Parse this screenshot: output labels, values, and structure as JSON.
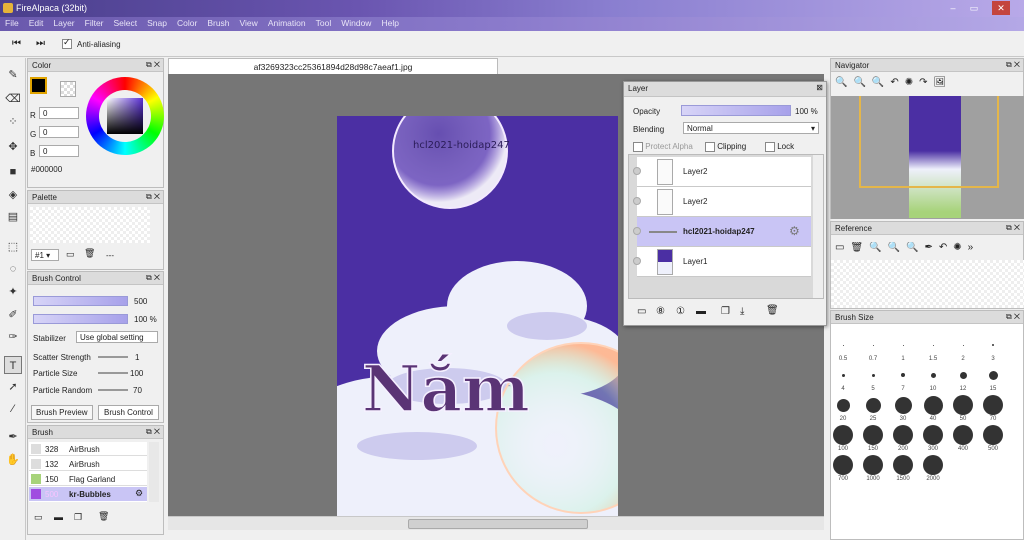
{
  "window": {
    "title": "FireAlpaca (32bit)",
    "controls": [
      "–",
      "▭",
      "✕"
    ]
  },
  "menu": [
    "File",
    "Edit",
    "Layer",
    "Filter",
    "Select",
    "Snap",
    "Color",
    "Brush",
    "View",
    "Animation",
    "Tool",
    "Window",
    "Help"
  ],
  "toolbar": {
    "anti_aliasing": "Anti-aliasing"
  },
  "color_panel": {
    "title": "Color",
    "r_label": "R",
    "g_label": "G",
    "b_label": "B",
    "r": "0",
    "g": "0",
    "b": "0",
    "hex": "#000000"
  },
  "palette_panel": {
    "title": "Palette",
    "set": "#1",
    "more": "---"
  },
  "brush_control": {
    "title": "Brush Control",
    "size": "500",
    "opacity": "100 %",
    "stabilizer_label": "Stabilizer",
    "stabilizer_value": "Use global setting",
    "scatter_label": "Scatter Strength",
    "scatter_value": "1",
    "psize_label": "Particle Size",
    "psize_value": "100",
    "prandom_label": "Particle Random",
    "prandom_value": "70",
    "tab_preview": "Brush Preview",
    "tab_control": "Brush Control"
  },
  "brush_panel": {
    "title": "Brush",
    "items": [
      {
        "size": "328",
        "name": "AirBrush",
        "color": "#dddddd"
      },
      {
        "size": "132",
        "name": "AirBrush",
        "color": "#dddddd"
      },
      {
        "size": "150",
        "name": "Flag Garland",
        "color": "#a7d37a"
      },
      {
        "size": "500",
        "name": "kr-Bubbles",
        "color": "#a04de0"
      }
    ]
  },
  "document": {
    "tab": "af3269323cc25361894d28d98c7aeaf1.jpg",
    "watermark": "hcl2021-hoidap247",
    "art_text": "Nắm"
  },
  "layer_window": {
    "title": "Layer",
    "opacity_label": "Opacity",
    "opacity_value": "100 %",
    "blending_label": "Blending",
    "blending_value": "Normal",
    "protect_alpha": "Protect Alpha",
    "clipping": "Clipping",
    "lock": "Lock",
    "layers": [
      {
        "name": "Layer2"
      },
      {
        "name": "Layer2"
      },
      {
        "name": "hcl2021-hoidap247"
      },
      {
        "name": "Layer1"
      }
    ],
    "selected_index": 2
  },
  "navigator": {
    "title": "Navigator"
  },
  "reference": {
    "title": "Reference"
  },
  "brush_size": {
    "title": "Brush Size",
    "sizes": [
      "0.5",
      "0.7",
      "1",
      "1.5",
      "2",
      "3",
      "4",
      "5",
      "7",
      "10",
      "12",
      "15",
      "20",
      "25",
      "30",
      "40",
      "50",
      "70",
      "100",
      "150",
      "200",
      "300",
      "400",
      "500",
      "700",
      "1000",
      "1500",
      "2000"
    ]
  },
  "colors": {
    "accent": "#a7a1ea",
    "selection": "#c9c5f5",
    "art_bg": "#4b2fa3"
  }
}
